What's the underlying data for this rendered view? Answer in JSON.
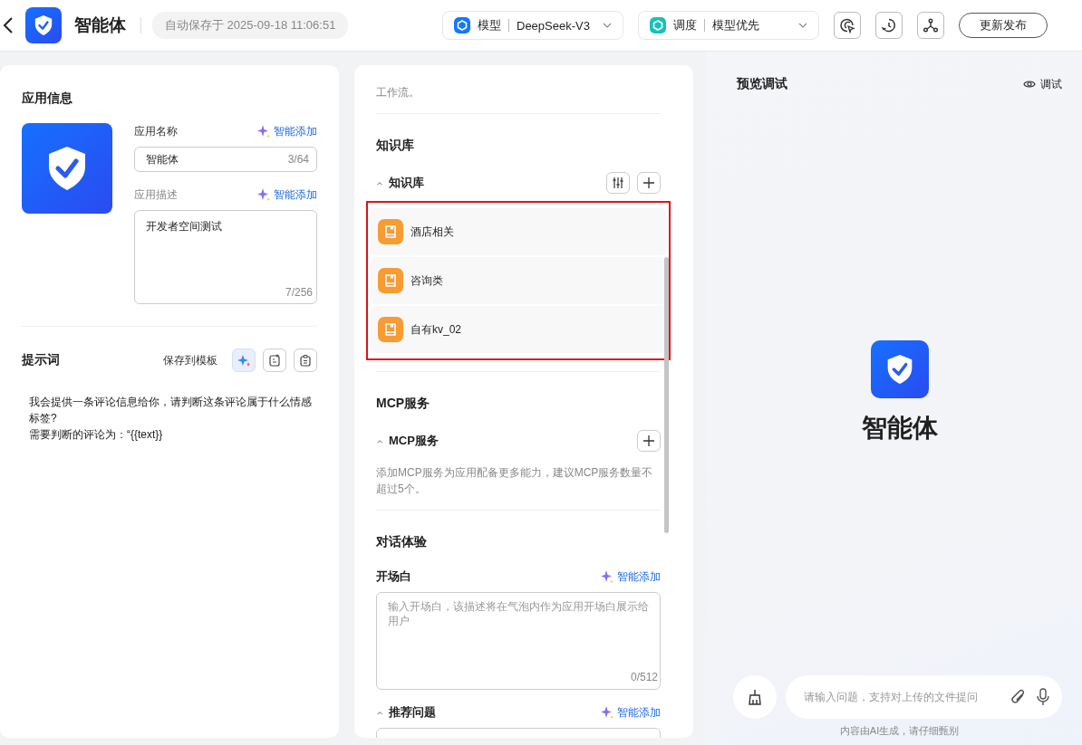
{
  "header": {
    "title": "智能体",
    "autosave": "自动保存于 2025-09-18 11:06:51",
    "selectors": [
      {
        "kind": "model",
        "label": "模型",
        "value": "DeepSeek-V3"
      },
      {
        "kind": "schedule",
        "label": "调度",
        "value": "模型优先"
      }
    ],
    "tools": [
      {
        "kind": "run"
      },
      {
        "kind": "history"
      },
      {
        "kind": "share"
      }
    ],
    "publish": "更新发布"
  },
  "app_info": {
    "title": "应用信息",
    "name_label": "应用名称",
    "name_ai": "智能添加",
    "name_value": "智能体",
    "name_count": "3/64",
    "desc_label": "应用描述",
    "desc_ai": "智能添加",
    "desc_value": "开发者空间测试",
    "desc_count": "7/256"
  },
  "prompt": {
    "title": "提示词",
    "save_template": "保存到模板",
    "text": "我会提供一条评论信息给你，请判断这条评论属于什么情感标签?\n需要判断的评论为：“{{text}}"
  },
  "config": {
    "top_text": "工作流。",
    "knowledge": {
      "title": "知识库",
      "group": "知识库",
      "expanded": true,
      "highlighted": true,
      "items": [
        {
          "name": "酒店相关"
        },
        {
          "name": "咨询类"
        },
        {
          "name": "自有kv_02"
        }
      ]
    },
    "mcp": {
      "title": "MCP服务",
      "group": "MCP服务",
      "expanded": true,
      "hint": "添加MCP服务为应用配备更多能力，建议MCP服务数量不超过5个。"
    },
    "dialog": {
      "title": "对话体验",
      "opening_label": "开场白",
      "opening_ai": "智能添加",
      "opening_placeholder": "输入开场白，该描述将在气泡内作为应用开场白展示给用户",
      "opening_count": "0/512",
      "questions_label": "推荐问题",
      "questions_expanded": true,
      "questions_ai": "智能添加"
    }
  },
  "preview": {
    "title": "预览调试",
    "debug": "调试",
    "agent_name": "智能体",
    "input_placeholder": "请输入问题，支持对上传的文件提问",
    "disclaimer": "内容由AI生成，请仔细甄别"
  }
}
